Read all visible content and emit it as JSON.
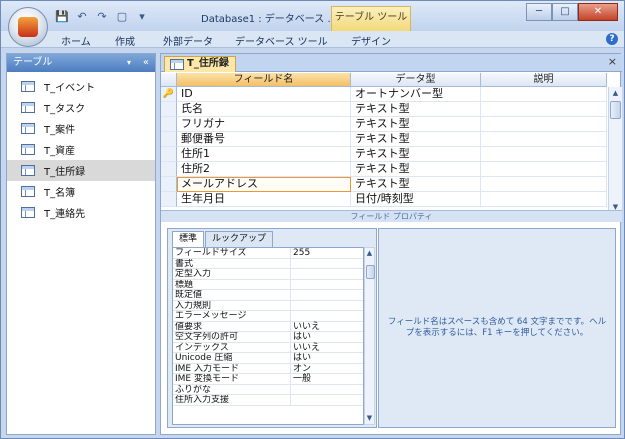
{
  "window": {
    "title": "Database1 : データベース ...",
    "contextual_tab": "テーブル ツール",
    "min_label": "─",
    "max_label": "□",
    "close_label": "✕"
  },
  "quick_access": {
    "save": "💾",
    "undo": "↶",
    "redo": "↷",
    "box": "▢",
    "customize": "▾"
  },
  "ribbon": {
    "tabs": [
      "ホーム",
      "作成",
      "外部データ",
      "データベース ツール",
      "デザイン"
    ],
    "help": "?"
  },
  "nav": {
    "header": "テーブル",
    "dropdown": "▾",
    "collapse": "«",
    "items": [
      {
        "label": "T_イベント"
      },
      {
        "label": "T_タスク"
      },
      {
        "label": "T_案件"
      },
      {
        "label": "T_資産"
      },
      {
        "label": "T_住所録"
      },
      {
        "label": "T_名簿"
      },
      {
        "label": "T_連絡先"
      }
    ],
    "selected_index": 4
  },
  "document": {
    "tab_label": "T_住所録",
    "close": "×",
    "columns": [
      "フィールド名",
      "データ型",
      "説明"
    ],
    "rows": [
      {
        "key": "🔑",
        "name": "ID",
        "type": "オートナンバー型",
        "desc": ""
      },
      {
        "key": "",
        "name": "氏名",
        "type": "テキスト型",
        "desc": ""
      },
      {
        "key": "",
        "name": "フリガナ",
        "type": "テキスト型",
        "desc": ""
      },
      {
        "key": "",
        "name": "郵便番号",
        "type": "テキスト型",
        "desc": ""
      },
      {
        "key": "",
        "name": "住所1",
        "type": "テキスト型",
        "desc": ""
      },
      {
        "key": "",
        "name": "住所2",
        "type": "テキスト型",
        "desc": ""
      },
      {
        "key": "",
        "name": "メールアドレス",
        "type": "テキスト型",
        "desc": ""
      },
      {
        "key": "",
        "name": "生年月日",
        "type": "日付/時刻型",
        "desc": ""
      }
    ],
    "editing_row": 6,
    "scroll_up": "▲",
    "scroll_down": "▼"
  },
  "field_properties": {
    "title": "フィールド プロパティ",
    "tabs": [
      "標準",
      "ルックアップ"
    ],
    "active_tab": 0,
    "rows": [
      {
        "k": "フィールドサイズ",
        "v": "255"
      },
      {
        "k": "書式",
        "v": ""
      },
      {
        "k": "定型入力",
        "v": ""
      },
      {
        "k": "標題",
        "v": ""
      },
      {
        "k": "既定値",
        "v": ""
      },
      {
        "k": "入力規則",
        "v": ""
      },
      {
        "k": "エラーメッセージ",
        "v": ""
      },
      {
        "k": "値要求",
        "v": "いいえ"
      },
      {
        "k": "空文字列の許可",
        "v": "はい"
      },
      {
        "k": "インデックス",
        "v": "いいえ"
      },
      {
        "k": "Unicode 圧縮",
        "v": "はい"
      },
      {
        "k": "IME 入力モード",
        "v": "オン"
      },
      {
        "k": "IME 変換モード",
        "v": "一般"
      },
      {
        "k": "ふりがな",
        "v": ""
      },
      {
        "k": "住所入力支援",
        "v": ""
      }
    ],
    "hint": "フィールド名はスペースも含めて 64 文字までです。ヘルプを表示するには、F1 キーを押してください。",
    "scroll_up": "▲",
    "scroll_down": "▼"
  },
  "colors": {
    "accent": "#4d7dc0",
    "selected_header": "#f3bf68",
    "tool_tab": "#f2d97a"
  }
}
